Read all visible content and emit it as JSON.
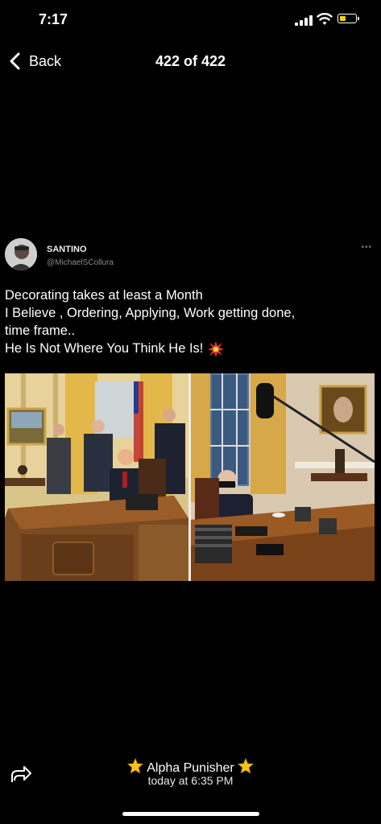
{
  "status_bar": {
    "time": "7:17",
    "battery_color": "#f5d300"
  },
  "nav": {
    "back_label": "Back",
    "counter": "422 of 422"
  },
  "tweet": {
    "username": "SANTINO",
    "handle": "@MichaelSCollura",
    "more": "•••",
    "lines": [
      "Decorating takes at least a Month",
      "I Believe , Ordering, Applying, Work getting done,",
      "time frame..",
      "He Is Not Where You Think He Is!"
    ],
    "emoji": "collision-icon",
    "image_description": "Side-by-side photos of the Oval Office desk"
  },
  "footer": {
    "sender": "Alpha Punisher",
    "timestamp": "today at 6:35 PM",
    "star_icon": "star-icon",
    "share_icon": "share-icon"
  }
}
